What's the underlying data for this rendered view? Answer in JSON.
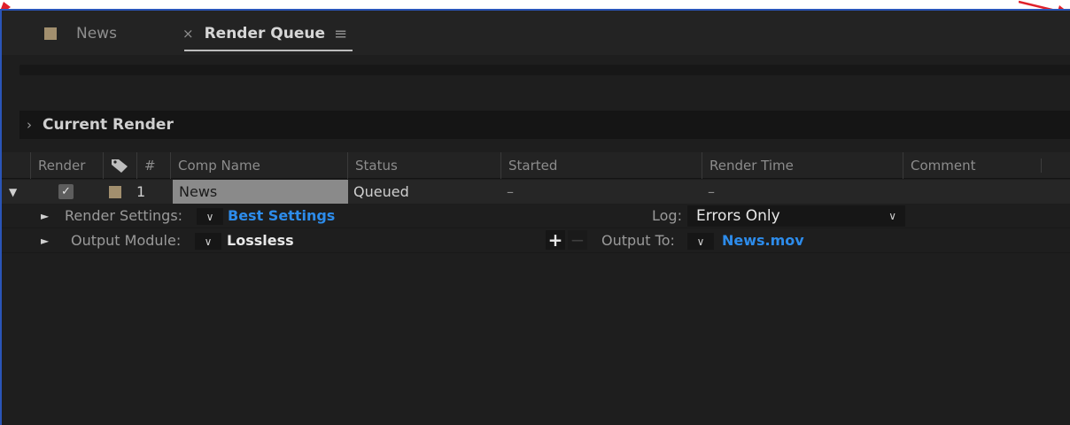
{
  "tabs": {
    "news_label": "News",
    "render_queue_label": "Render Queue",
    "close_glyph": "×",
    "menu_glyph": "≡"
  },
  "current_render": {
    "chevron": "›",
    "title": "Current Render"
  },
  "columns": {
    "render": "Render",
    "number": "#",
    "comp_name": "Comp Name",
    "status": "Status",
    "started": "Started",
    "render_time": "Render Time",
    "comment": "Comment"
  },
  "item": {
    "checkbox_glyph": "✓",
    "number": "1",
    "comp_name": "News",
    "status": "Queued",
    "started": "–",
    "render_time": "–"
  },
  "render_settings": {
    "label": "Render Settings:",
    "value": "Best Settings",
    "log_label": "Log:",
    "log_value": "Errors Only"
  },
  "output_module": {
    "label": "Output Module:",
    "value": "Lossless",
    "output_to_label": "Output To:",
    "output_to_value": "News.mov",
    "add_glyph": "+",
    "remove_glyph": "−"
  },
  "colors": {
    "panel_bg": "#1e1e1e",
    "link_blue": "#2d8ceb",
    "label_tan": "#a28f6e",
    "frame_border": "#2a55b8"
  }
}
